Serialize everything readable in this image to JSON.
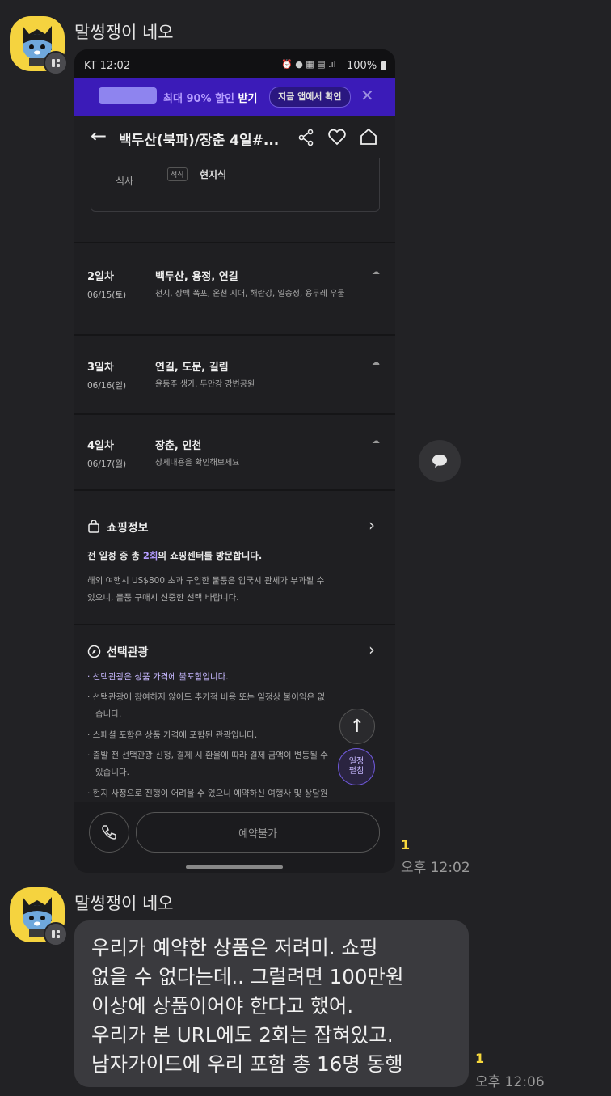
{
  "messages": [
    {
      "sender": "말썽쟁이 네오",
      "unread": "1",
      "time": "오후 12:02",
      "screenshot": {
        "status": {
          "carrier_time": "KT 12:02",
          "battery": "100%"
        },
        "banner": {
          "logo": "",
          "text_prefix": "최대 ",
          "text_highlight": "90% 할인",
          "text_suffix": " 받기",
          "button": "지금 앱에서 확인"
        },
        "header": {
          "title": "백두산(북파)/장춘 4일#..."
        },
        "meal": {
          "label": "식사",
          "tag": "석식",
          "value": "현지식"
        },
        "days": [
          {
            "day": "2일차",
            "date": "06/15(토)",
            "places": "백두산, 용정, 연길",
            "desc": "천지, 장백 폭포, 온천 지대, 해란강, 일송정, 용두레 우물"
          },
          {
            "day": "3일차",
            "date": "06/16(일)",
            "places": "연길, 도문, 길림",
            "desc": "윤동주 생가, 두만강 강변공원"
          },
          {
            "day": "4일차",
            "date": "06/17(월)",
            "places": "장춘, 인천",
            "desc": "상세내용을 확인해보세요"
          }
        ],
        "shopping": {
          "title": "쇼핑정보",
          "summary_prefix": "전 일정 중 총 ",
          "summary_count": "2회",
          "summary_suffix": "의 쇼핑센터를 방문합니다.",
          "desc_line1": "해외 여행시 US$800 초과 구입한 물품은 입국시 관세가 부과될 수",
          "desc_line2": "있으니, 물품 구매시 신중한 선택 바랍니다."
        },
        "optional": {
          "title": "선택관광",
          "line1": "· 선택관광은 상품 가격에 불포함입니다.",
          "line2": "· 선택관광에 참여하지 않아도 추가적 비용 또는 일정상 불이익은 없",
          "line3": "습니다.",
          "line4": "· 스페셜 포함은 상품 가격에 포함된 관광입니다.",
          "line5": "· 출발 전 선택관광 신청, 결제 시 환율에 따라 결제 금액이 변동될 수",
          "line6": "있습니다.",
          "line7": "· 현지 사정으로 진행이 어려울 수 있으니 예약하신 여행사 및 상담원"
        },
        "fab_schedule": {
          "line1": "일정",
          "line2": "펼침"
        },
        "reserve_button": "예약불가"
      }
    },
    {
      "sender": "말썽쟁이 네오",
      "unread": "1",
      "time": "오후 12:06",
      "text_lines": [
        "우리가 예약한 상품은 저려미. 쇼핑",
        "없을 수 없다는데.. 그럴려면 100만원",
        "이상에 상품이어야 한다고 했어.",
        "우리가 본 URL에도 2회는 잡혀있고.",
        "남자가이드에 우리 포함 총 16명 동행"
      ]
    }
  ],
  "colors": {
    "background": "#222225",
    "bubble": "#3a3a3e",
    "unread": "#f7d83c",
    "banner": "#3b1bb8",
    "accent_purple": "#b49cff"
  }
}
